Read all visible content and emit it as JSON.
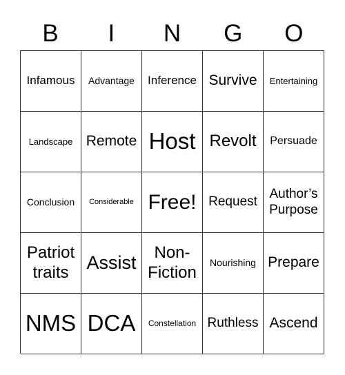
{
  "header": {
    "letters": [
      "B",
      "I",
      "N",
      "G",
      "O"
    ]
  },
  "card": {
    "rows": [
      [
        "Infamous",
        "Advantage",
        "Inference",
        "Survive",
        "Entertaining"
      ],
      [
        "Landscape",
        "Remote",
        "Host",
        "Revolt",
        "Persuade"
      ],
      [
        "Conclusion",
        "Considerable",
        "Free!",
        "Request",
        "Author’s Purpose"
      ],
      [
        "Patriot traits",
        "Assist",
        "Non-Fiction",
        "Nourishing",
        "Prepare"
      ],
      [
        "NMS",
        "DCA",
        "Constellation",
        "Ruthless",
        "Ascend"
      ]
    ],
    "multiline": {
      "r2c4": [
        "Author’s",
        "Purpose"
      ],
      "r3c0": [
        "Patriot",
        "traits"
      ],
      "r3c2": [
        "Non-",
        "Fiction"
      ]
    }
  }
}
